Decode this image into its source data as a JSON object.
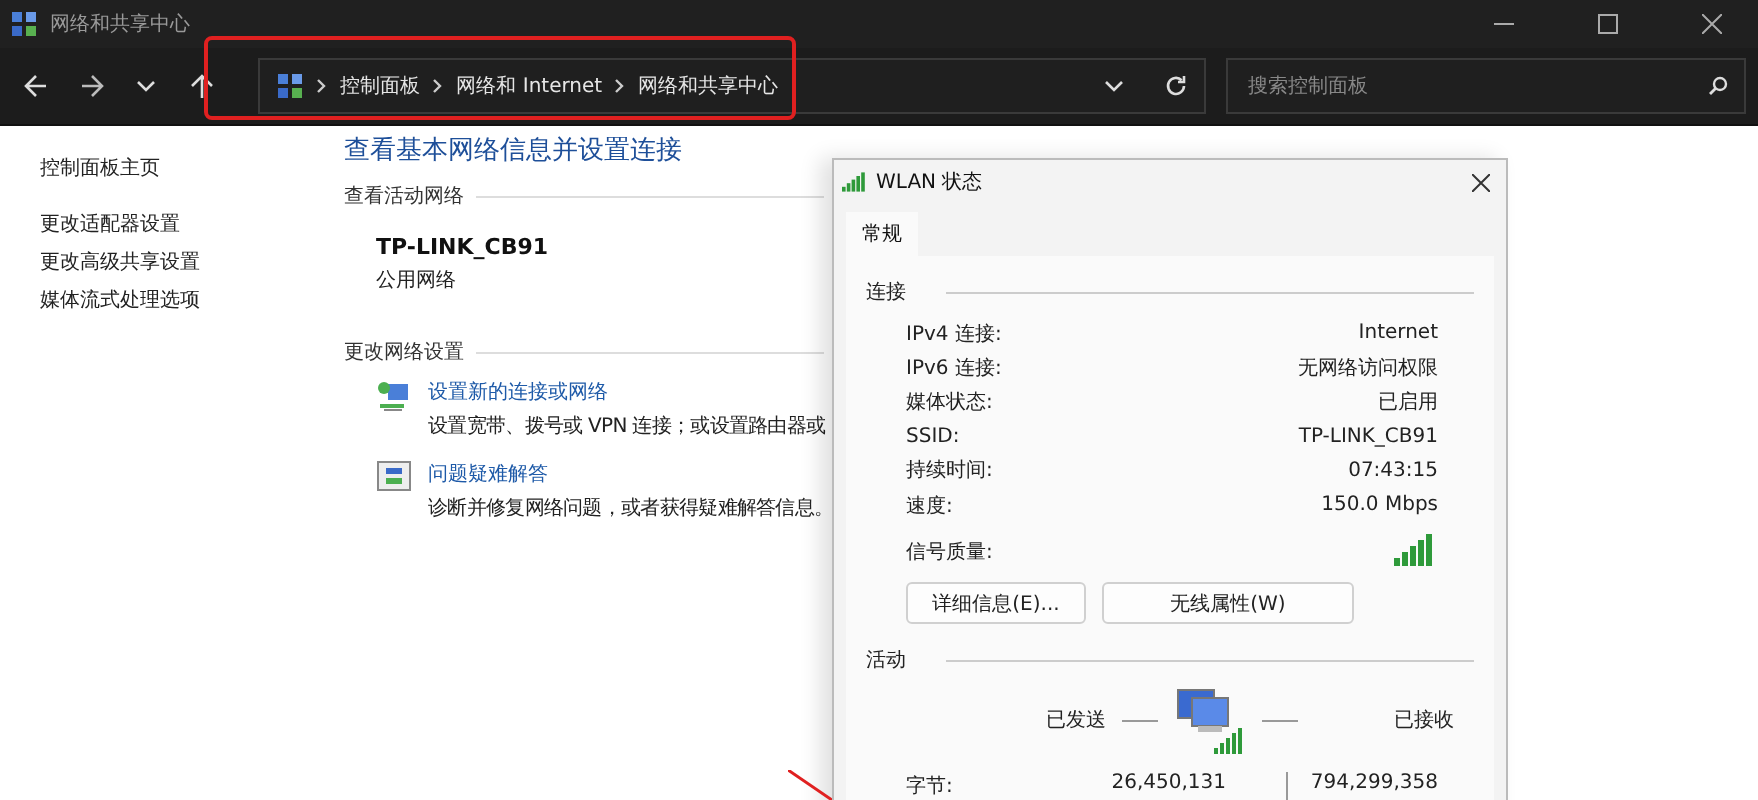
{
  "window": {
    "title": "网络和共享中心"
  },
  "address_bar": {
    "breadcrumbs": [
      "控制面板",
      "网络和 Internet",
      "网络和共享中心"
    ]
  },
  "search": {
    "placeholder": "搜索控制面板"
  },
  "sidebar": {
    "home": "控制面板主页",
    "items": [
      "更改适配器设置",
      "更改高级共享设置",
      "媒体流式处理选项"
    ]
  },
  "main": {
    "title": "查看基本网络信息并设置连接",
    "active_heading": "查看活动网络",
    "network": {
      "name": "TP-LINK_CB91",
      "type": "公用网络"
    },
    "settings_heading": "更改网络设置",
    "tasks": [
      {
        "kind": "setup",
        "link": "设置新的连接或网络",
        "description": "设置宽带、拨号或 VPN 连接；或设置路由器或"
      },
      {
        "kind": "troubleshoot",
        "link": "问题疑难解答",
        "description": "诊断并修复网络问题，或者获得疑难解答信息。"
      }
    ]
  },
  "dialog": {
    "title": "WLAN 状态",
    "tabs": [
      {
        "label": "常规",
        "selected": true
      }
    ],
    "connection_heading": "连接",
    "fields": [
      {
        "label": "IPv4 连接:",
        "value": "Internet"
      },
      {
        "label": "IPv6 连接:",
        "value": "无网络访问权限"
      },
      {
        "label": "媒体状态:",
        "value": "已启用"
      },
      {
        "label": "SSID:",
        "value": "TP-LINK_CB91"
      },
      {
        "label": "持续时间:",
        "value": "07:43:15"
      },
      {
        "label": "速度:",
        "value": "150.0 Mbps"
      }
    ],
    "signal_label": "信号质量:",
    "buttons": [
      "详细信息(E)...",
      "无线属性(W)"
    ],
    "activity_heading": "活动",
    "sent_label": "已发送",
    "received_label": "已接收",
    "bytes": {
      "label": "字节:",
      "sent": "26,450,131",
      "received": "794,299,358"
    }
  }
}
